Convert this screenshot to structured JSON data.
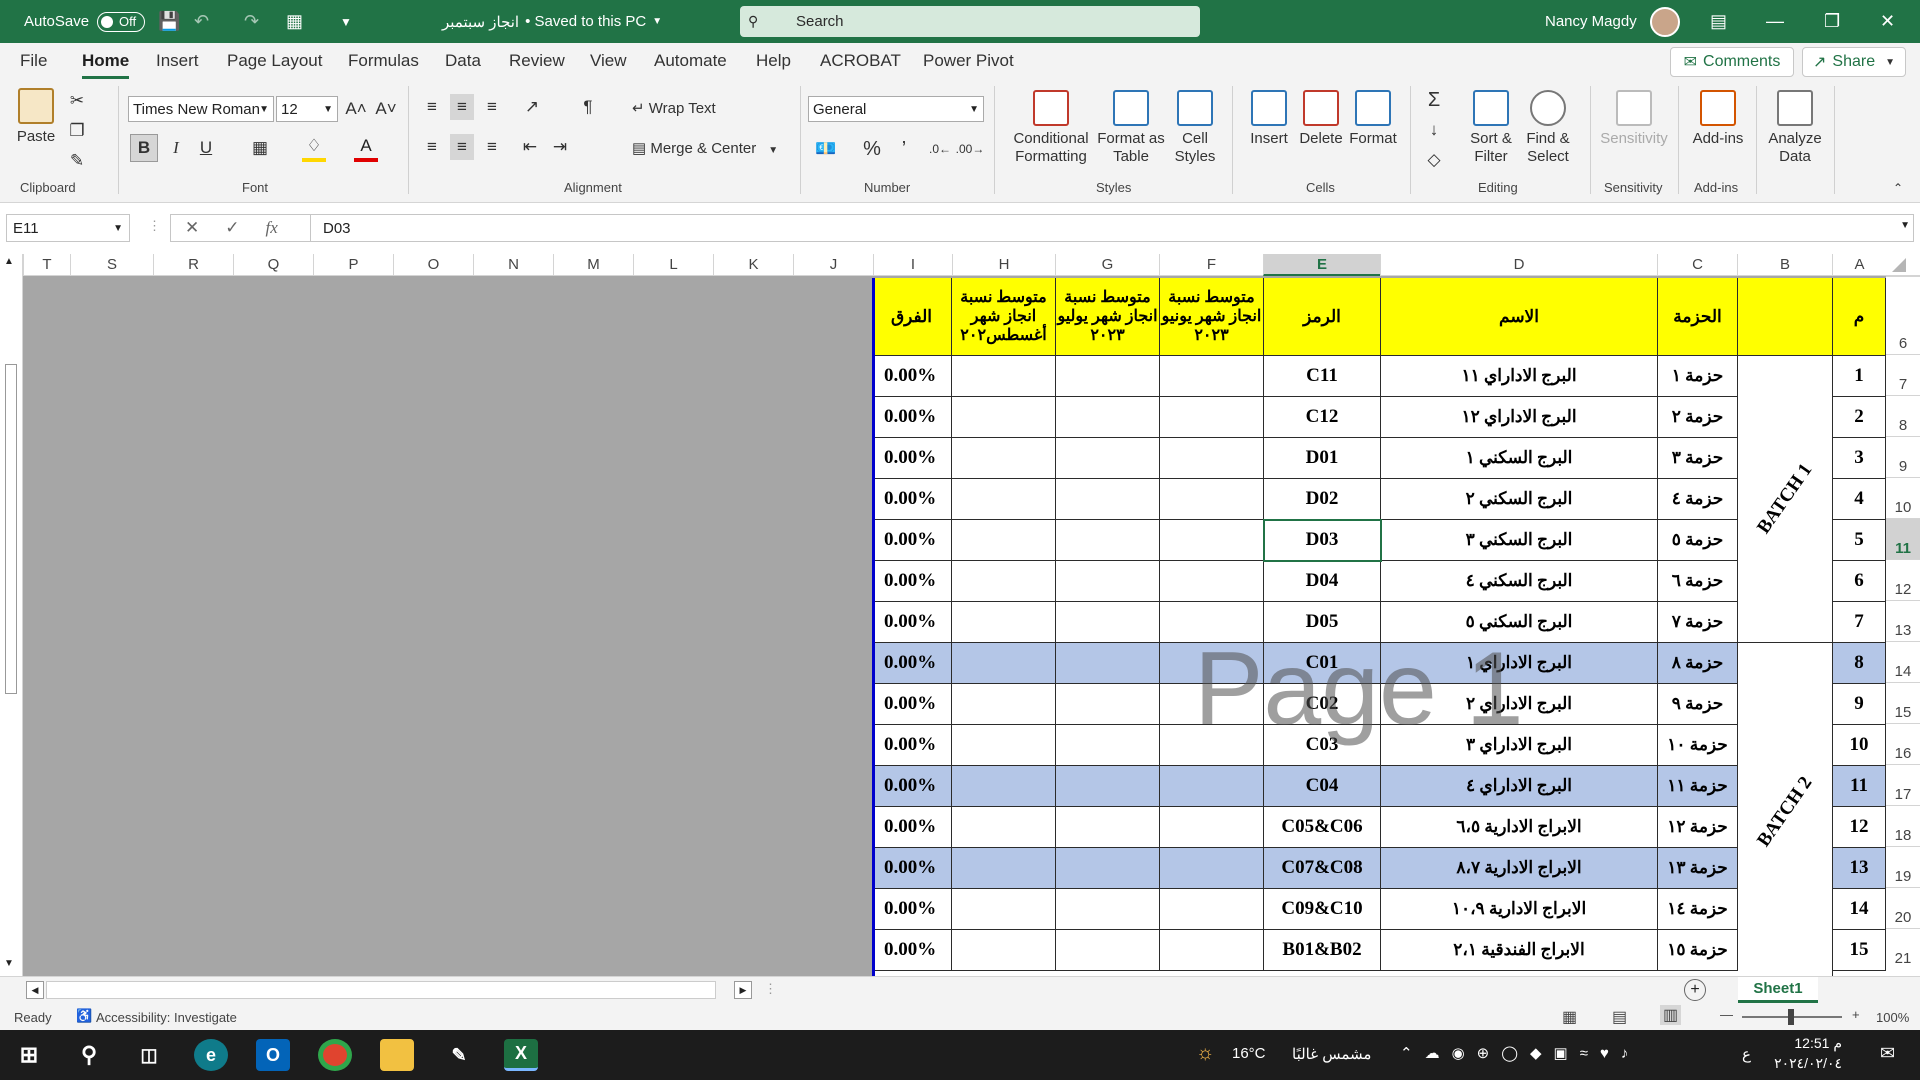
{
  "titlebar": {
    "autosave_label": "AutoSave",
    "autosave_state": "Off",
    "file_name": "انجاز سبتمبر",
    "save_status": "• Saved to this PC",
    "search_placeholder": "Search",
    "user_name": "Nancy Magdy"
  },
  "tabs": [
    "File",
    "Home",
    "Insert",
    "Page Layout",
    "Formulas",
    "Data",
    "Review",
    "View",
    "Automate",
    "Help",
    "ACROBAT",
    "Power Pivot"
  ],
  "comments_label": "Comments",
  "share_label": "Share",
  "ribbon": {
    "paste_label": "Paste",
    "clipboard_label": "Clipboard",
    "font_name": "Times New Roman",
    "font_size": "12",
    "font_label": "Font",
    "bold": "B",
    "italic": "I",
    "underline": "U",
    "wrap_text": "Wrap Text",
    "merge_center": "Merge & Center",
    "alignment_label": "Alignment",
    "number_format": "General",
    "number_label": "Number",
    "conditional_formatting": [
      "Conditional",
      "Formatting"
    ],
    "format_as_table": [
      "Format as",
      "Table"
    ],
    "cell_styles": [
      "Cell",
      "Styles"
    ],
    "styles_label": "Styles",
    "insert": "Insert",
    "delete": "Delete",
    "format": "Format",
    "cells_label": "Cells",
    "sort_filter": [
      "Sort &",
      "Filter"
    ],
    "find_select": [
      "Find &",
      "Select"
    ],
    "editing_label": "Editing",
    "sensitivity": "Sensitivity",
    "sensitivity_label": "Sensitivity",
    "addins": "Add-ins",
    "addins_label": "Add-ins",
    "analyze_data": [
      "Analyze",
      "Data"
    ]
  },
  "formula_bar": {
    "name_box": "E11",
    "fx": "fx",
    "content": "D03"
  },
  "columns": [
    "T",
    "S",
    "R",
    "Q",
    "P",
    "O",
    "N",
    "M",
    "L",
    "K",
    "J",
    "I",
    "H",
    "G",
    "F",
    "E",
    "D",
    "C",
    "B",
    "A"
  ],
  "selected_column": "E",
  "rows": [
    "6",
    "7",
    "8",
    "9",
    "10",
    "11",
    "12",
    "13",
    "14",
    "15",
    "16",
    "17",
    "18",
    "19",
    "20",
    "21"
  ],
  "selected_row": "11",
  "table": {
    "headers": {
      "m": "م",
      "batch": "",
      "package": "الحزمة",
      "name": "الاسم",
      "code": "الرمز",
      "june": "متوسط نسبة انجاز شهر يونيو ٢٠٢٣",
      "july": "متوسط نسبة انجاز شهر يوليو ٢٠٢٣",
      "august": "متوسط نسبة انجاز شهر أغسطس٢٠٢",
      "diff": "الفرق"
    },
    "batch_labels": [
      "BATCH 1",
      "BATCH 2"
    ],
    "rows": [
      {
        "m": "1",
        "package": "حزمة ١",
        "name": "البرج الاداراي ١١",
        "code": "C11",
        "diff": "0.00%",
        "highlight": false
      },
      {
        "m": "2",
        "package": "حزمة ٢",
        "name": "البرج الاداراي ١٢",
        "code": "C12",
        "diff": "0.00%",
        "highlight": false
      },
      {
        "m": "3",
        "package": "حزمة ٣",
        "name": "البرج السكني ١",
        "code": "D01",
        "diff": "0.00%",
        "highlight": false
      },
      {
        "m": "4",
        "package": "حزمة ٤",
        "name": "البرج السكني ٢",
        "code": "D02",
        "diff": "0.00%",
        "highlight": false
      },
      {
        "m": "5",
        "package": "حزمة ٥",
        "name": "البرج السكني ٣",
        "code": "D03",
        "diff": "0.00%",
        "highlight": false
      },
      {
        "m": "6",
        "package": "حزمة ٦",
        "name": "البرج السكني ٤",
        "code": "D04",
        "diff": "0.00%",
        "highlight": false
      },
      {
        "m": "7",
        "package": "حزمة ٧",
        "name": "البرج السكني ٥",
        "code": "D05",
        "diff": "0.00%",
        "highlight": false
      },
      {
        "m": "8",
        "package": "حزمة ٨",
        "name": "البرج الاداراي ١",
        "code": "C01",
        "diff": "0.00%",
        "highlight": true
      },
      {
        "m": "9",
        "package": "حزمة ٩",
        "name": "البرج الاداراي ٢",
        "code": "C02",
        "diff": "0.00%",
        "highlight": false
      },
      {
        "m": "10",
        "package": "حزمة ١٠",
        "name": "البرج الاداراي ٣",
        "code": "C03",
        "diff": "0.00%",
        "highlight": false
      },
      {
        "m": "11",
        "package": "حزمة ١١",
        "name": "البرج الاداراي ٤",
        "code": "C04",
        "diff": "0.00%",
        "highlight": true
      },
      {
        "m": "12",
        "package": "حزمة ١٢",
        "name": "الابراج الادارية ٦،٥",
        "code": "C05&C06",
        "diff": "0.00%",
        "highlight": false
      },
      {
        "m": "13",
        "package": "حزمة ١٣",
        "name": "الابراج الادارية ٨،٧",
        "code": "C07&C08",
        "diff": "0.00%",
        "highlight": true
      },
      {
        "m": "14",
        "package": "حزمة ١٤",
        "name": "الابراج الادارية ١٠،٩",
        "code": "C09&C10",
        "diff": "0.00%",
        "highlight": false
      },
      {
        "m": "15",
        "package": "حزمة ١٥",
        "name": "الابراج الفندقية ٢،١",
        "code": "B01&B02",
        "diff": "0.00%",
        "highlight": false
      }
    ]
  },
  "watermark": "Page 1",
  "sheet_tab": "Sheet1",
  "status": {
    "ready": "Ready",
    "accessibility": "Accessibility: Investigate",
    "zoom": "100%"
  },
  "taskbar": {
    "temperature": "16°C",
    "weather": "مشمس غالبًا",
    "lang": "ع",
    "time": "12:51 م",
    "date": "٢٠٢٤/٠٢/٠٤"
  }
}
